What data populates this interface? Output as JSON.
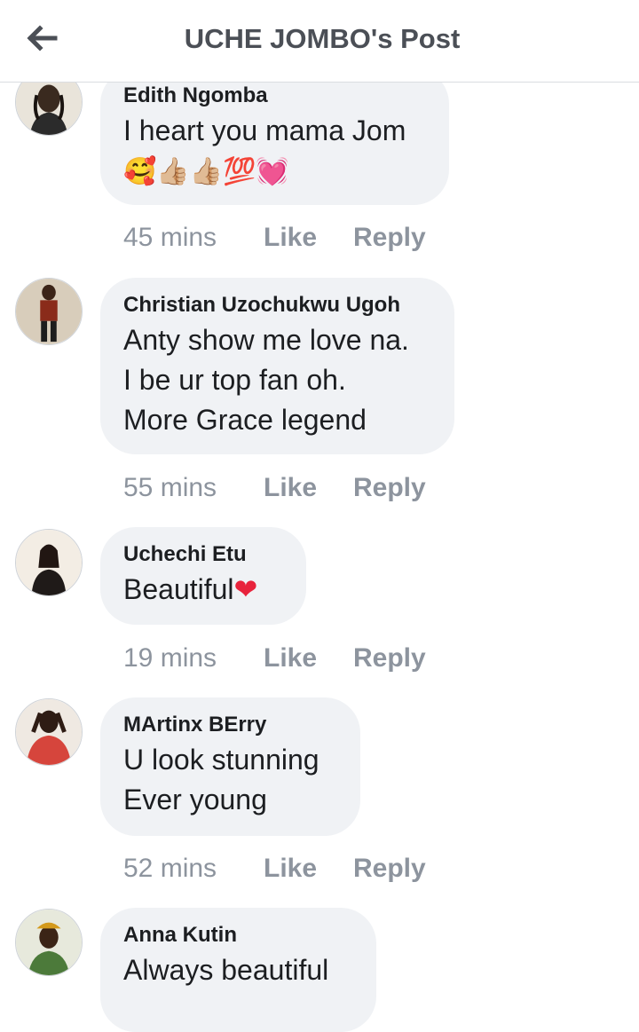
{
  "header": {
    "title": "UCHE JOMBO's Post",
    "back_icon": "arrow-left-icon"
  },
  "actions": {
    "like": "Like",
    "reply": "Reply"
  },
  "comments": [
    {
      "author": "Edith Ngomba",
      "lines": [
        "I heart you mama Jom"
      ],
      "emoji": "🥰👍🏼👍🏼💯💓",
      "time": "45 mins"
    },
    {
      "author": "Christian Uzochukwu Ugoh",
      "lines": [
        "Anty show me love na.",
        "I be ur top fan oh.",
        "More Grace legend"
      ],
      "time": "55 mins"
    },
    {
      "author": "Uchechi Etu",
      "lines": [
        "Beautiful"
      ],
      "emoji_inline": "❤",
      "time": "19 mins"
    },
    {
      "author": "MArtinx BErry",
      "lines": [
        "U look stunning",
        "Ever young"
      ],
      "time": "52 mins"
    },
    {
      "author": "Anna Kutin",
      "lines": [
        "Always beautiful"
      ]
    }
  ],
  "colors": {
    "bubble": "#f0f2f5",
    "meta_text": "#8d949e",
    "title_text": "#4b4f56",
    "heart": "#e8233c"
  }
}
